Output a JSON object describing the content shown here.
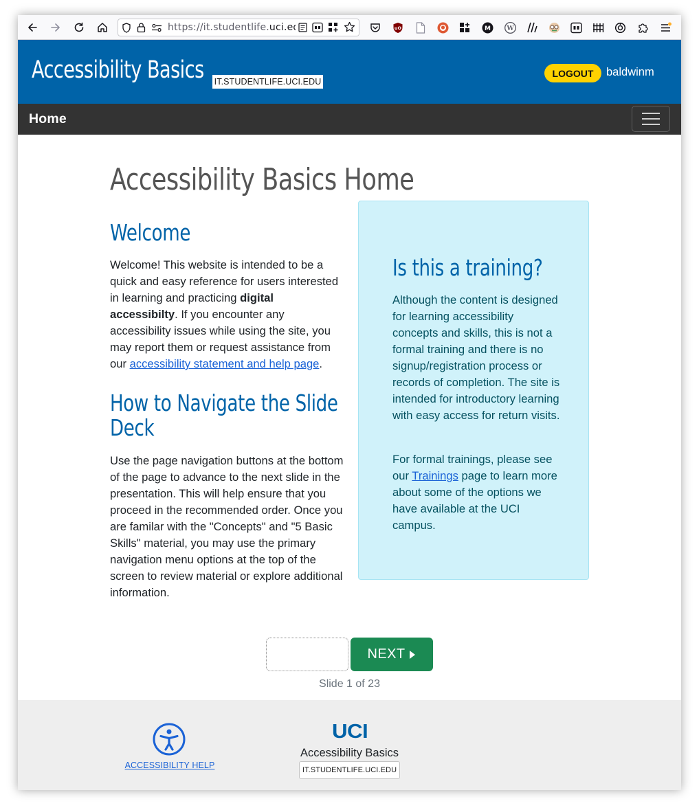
{
  "browser": {
    "url_prefix": "https://it.studentlife.",
    "url_domain": "uci.edu"
  },
  "header": {
    "site_title": "Accessibility Basics",
    "site_badge": "IT.STUDENTLIFE.UCI.EDU",
    "logout_label": "LOGOUT",
    "username": "baldwinm"
  },
  "nav": {
    "home_label": "Home"
  },
  "main": {
    "page_title": "Accessibility Basics Home",
    "welcome": {
      "heading": "Welcome",
      "text_1": "Welcome! This website is intended to be a quick and easy reference for users interested in learning and practicing ",
      "bold": "digital accessibilty",
      "text_2": ". If you encounter any accessibility issues while using the site, you may report them or request assistance from our ",
      "link": "accessibility statement and help page",
      "text_3": "."
    },
    "navigate": {
      "heading_line1": "How to Navigate the Slide",
      "heading_line2": "Deck",
      "text": "Use the page navigation buttons at the bottom of the page to advance to the next slide in the presentation. This will help ensure that you proceed in the recommended order. Once you are familar with the \"Concepts\" and \"5 Basic Skills\" material, you may use the primary navigation menu options at the top of the screen to review material or explore additional information."
    },
    "callout": {
      "heading": "Is this a training?",
      "para_1": "Although the content is designed for learning accessibility concepts and skills, this is not a formal training and there is no signup/registration process or records of completion. The site is intended for introductory learning with easy access for return visits.",
      "para_2_before": "For formal trainings, please see our ",
      "para_2_link": "Trainings",
      "para_2_after": " page to learn more about some of the options we have available at the UCI campus."
    }
  },
  "pager": {
    "next_label": "NEXT",
    "slide_count": "Slide 1 of 23"
  },
  "footer": {
    "a11y_link": "ACCESSIBILITY HELP",
    "logo": "UCI",
    "site_name": "Accessibility Basics",
    "site_badge": "IT.STUDENTLIFE.UCI.EDU"
  },
  "colors": {
    "brand_blue": "#0063a8",
    "nav_dark": "#333333",
    "logout_yellow": "#ffd200",
    "next_green": "#1b8a53",
    "callout_bg": "#d0f2fa"
  }
}
